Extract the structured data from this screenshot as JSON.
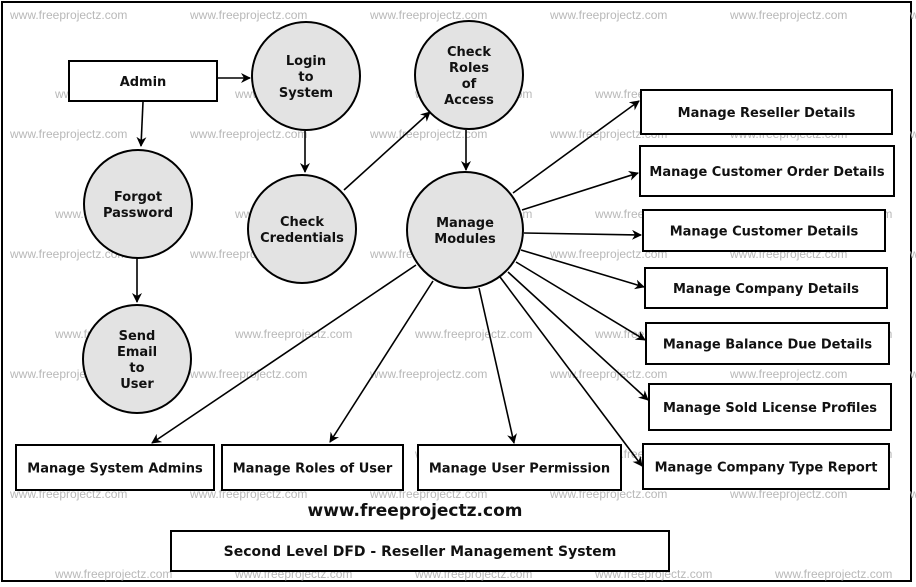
{
  "diagram": {
    "title": "Second Level DFD - Reseller Management System",
    "website": "www.freeprojectz.com",
    "watermark": "www.freeprojectz.com",
    "colors": {
      "process_fill": "#e3e3e3",
      "stroke": "#000000",
      "watermark": "#b8b8b8"
    },
    "entities": [
      {
        "id": "admin",
        "label": "Admin"
      },
      {
        "id": "reseller",
        "label": "Manage Reseller Details"
      },
      {
        "id": "custorder",
        "label": "Manage Customer Order Details"
      },
      {
        "id": "customer",
        "label": "Manage Customer Details"
      },
      {
        "id": "company",
        "label": "Manage Company Details"
      },
      {
        "id": "balance",
        "label": "Manage Balance Due Details"
      },
      {
        "id": "license",
        "label": "Manage Sold License Profiles"
      },
      {
        "id": "comptype",
        "label": "Manage Company Type Report"
      },
      {
        "id": "sysadmins",
        "label": "Manage System Admins"
      },
      {
        "id": "roles",
        "label": "Manage Roles of User"
      },
      {
        "id": "permission",
        "label": "Manage User Permission"
      }
    ],
    "processes": [
      {
        "id": "login",
        "lines": [
          "Login",
          "to",
          "System"
        ]
      },
      {
        "id": "checkroles",
        "lines": [
          "Check",
          "Roles",
          "of",
          "Access"
        ]
      },
      {
        "id": "forgot",
        "lines": [
          "Forgot",
          "Password"
        ]
      },
      {
        "id": "credentials",
        "lines": [
          "Check",
          "Credentials"
        ]
      },
      {
        "id": "modules",
        "lines": [
          "Manage",
          "Modules"
        ]
      },
      {
        "id": "sendemail",
        "lines": [
          "Send",
          "Email",
          "to",
          "User"
        ]
      }
    ],
    "flows": [
      {
        "from": "admin",
        "to": "login"
      },
      {
        "from": "admin",
        "to": "forgot"
      },
      {
        "from": "login",
        "to": "credentials"
      },
      {
        "from": "credentials",
        "to": "checkroles"
      },
      {
        "from": "checkroles",
        "to": "modules"
      },
      {
        "from": "forgot",
        "to": "sendemail"
      },
      {
        "from": "modules",
        "to": "reseller"
      },
      {
        "from": "modules",
        "to": "custorder"
      },
      {
        "from": "modules",
        "to": "customer"
      },
      {
        "from": "modules",
        "to": "company"
      },
      {
        "from": "modules",
        "to": "balance"
      },
      {
        "from": "modules",
        "to": "license"
      },
      {
        "from": "modules",
        "to": "comptype"
      },
      {
        "from": "modules",
        "to": "sysadmins"
      },
      {
        "from": "modules",
        "to": "roles"
      },
      {
        "from": "modules",
        "to": "permission"
      }
    ]
  }
}
